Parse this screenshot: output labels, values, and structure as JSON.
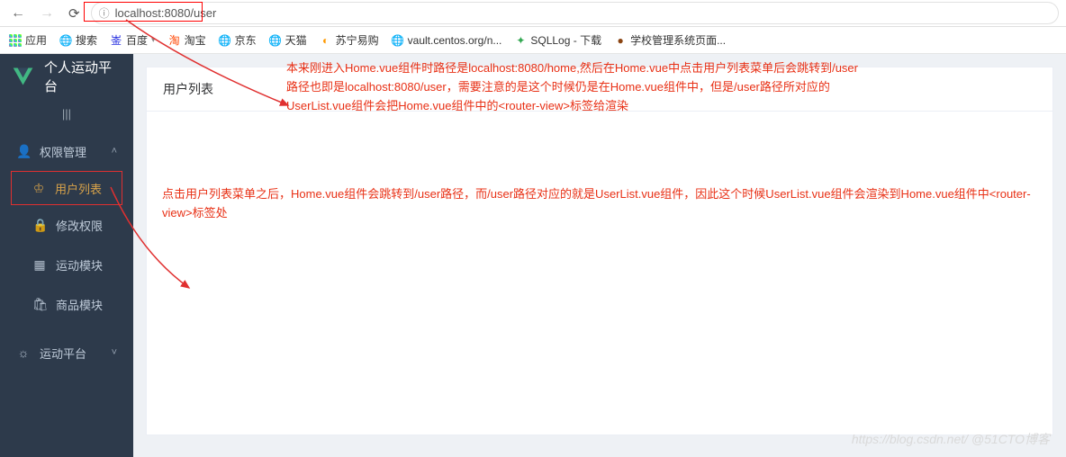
{
  "browser": {
    "url": "localhost:8080/user"
  },
  "bookmarks": [
    {
      "label": "应用"
    },
    {
      "label": "搜索"
    },
    {
      "label": "百度"
    },
    {
      "label": "淘宝"
    },
    {
      "label": "京东"
    },
    {
      "label": "天猫"
    },
    {
      "label": "苏宁易购"
    },
    {
      "label": "vault.centos.org/n..."
    },
    {
      "label": "SQLLog - 下载"
    },
    {
      "label": "学校管理系统页面..."
    }
  ],
  "app_title": "个人运动平台",
  "sidebar": {
    "items": [
      {
        "label": "权限管理",
        "icon": "user",
        "expandable": true
      },
      {
        "label": "用户列表",
        "icon": "user-outline",
        "sub": true,
        "active": true
      },
      {
        "label": "修改权限",
        "icon": "lock",
        "sub": true
      },
      {
        "label": "运动模块",
        "icon": "grid",
        "sub": true
      },
      {
        "label": "商品模块",
        "icon": "bag",
        "sub": true
      },
      {
        "label": "运动平台",
        "icon": "sun",
        "expandable": true
      }
    ]
  },
  "content": {
    "card_title": "用户列表"
  },
  "annotations": {
    "a1": "本来刚进入Home.vue组件时路径是localhost:8080/home,然后在Home.vue中点击用户列表菜单后会跳转到/user路径也即是localhost:8080/user，需要注意的是这个时候仍是在Home.vue组件中，但是/user路径所对应的UserList.vue组件会把Home.vue组件中的<router-view>标签给渲染",
    "a2": "点击用户列表菜单之后，Home.vue组件会跳转到/user路径，而/user路径对应的就是UserList.vue组件，因此这个时候UserList.vue组件会渲染到Home.vue组件中<router-view>标签处"
  },
  "watermark": "https://blog.csdn.net/ @51CTO博客"
}
